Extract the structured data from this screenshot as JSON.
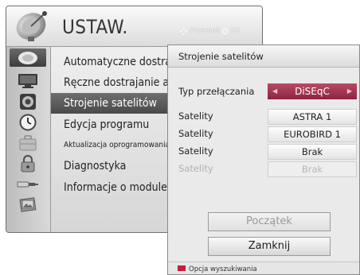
{
  "main": {
    "title": "USTAW.",
    "hint_move": "Przenieś",
    "hint_ok": "OK",
    "icons": [
      "satellite-dish-icon",
      "monitor-icon",
      "speaker-icon",
      "clock-icon",
      "suitcase-icon",
      "lock-icon",
      "input-plug-icon",
      "photo-icon"
    ],
    "items": [
      {
        "label": "Automatyczne dostrajanie"
      },
      {
        "label": "Ręczne dostrajanie anteny"
      },
      {
        "label": "Strojenie satelitów"
      },
      {
        "label": "Edycja programu"
      },
      {
        "label": "Aktualizacja oprogramowania"
      },
      {
        "label": "Diagnostyka"
      },
      {
        "label": "Informacje o module CI"
      }
    ]
  },
  "dialog": {
    "title": "Strojenie satelitów",
    "switch_label": "Typ przełączania",
    "switch_value": "DiSEqC",
    "satellites": [
      {
        "label": "Satelity",
        "value": "ASTRA 1",
        "enabled": true
      },
      {
        "label": "Satelity",
        "value": "EUROBIRD 1",
        "enabled": true
      },
      {
        "label": "Satelity",
        "value": "Brak",
        "enabled": true
      },
      {
        "label": "Satelity",
        "value": "Brak",
        "enabled": false
      }
    ],
    "start_button": "Początek",
    "close_button": "Zamknij",
    "footer_text": "Opcja wyszukiwania",
    "footer_key_color": "#c41e3a"
  }
}
